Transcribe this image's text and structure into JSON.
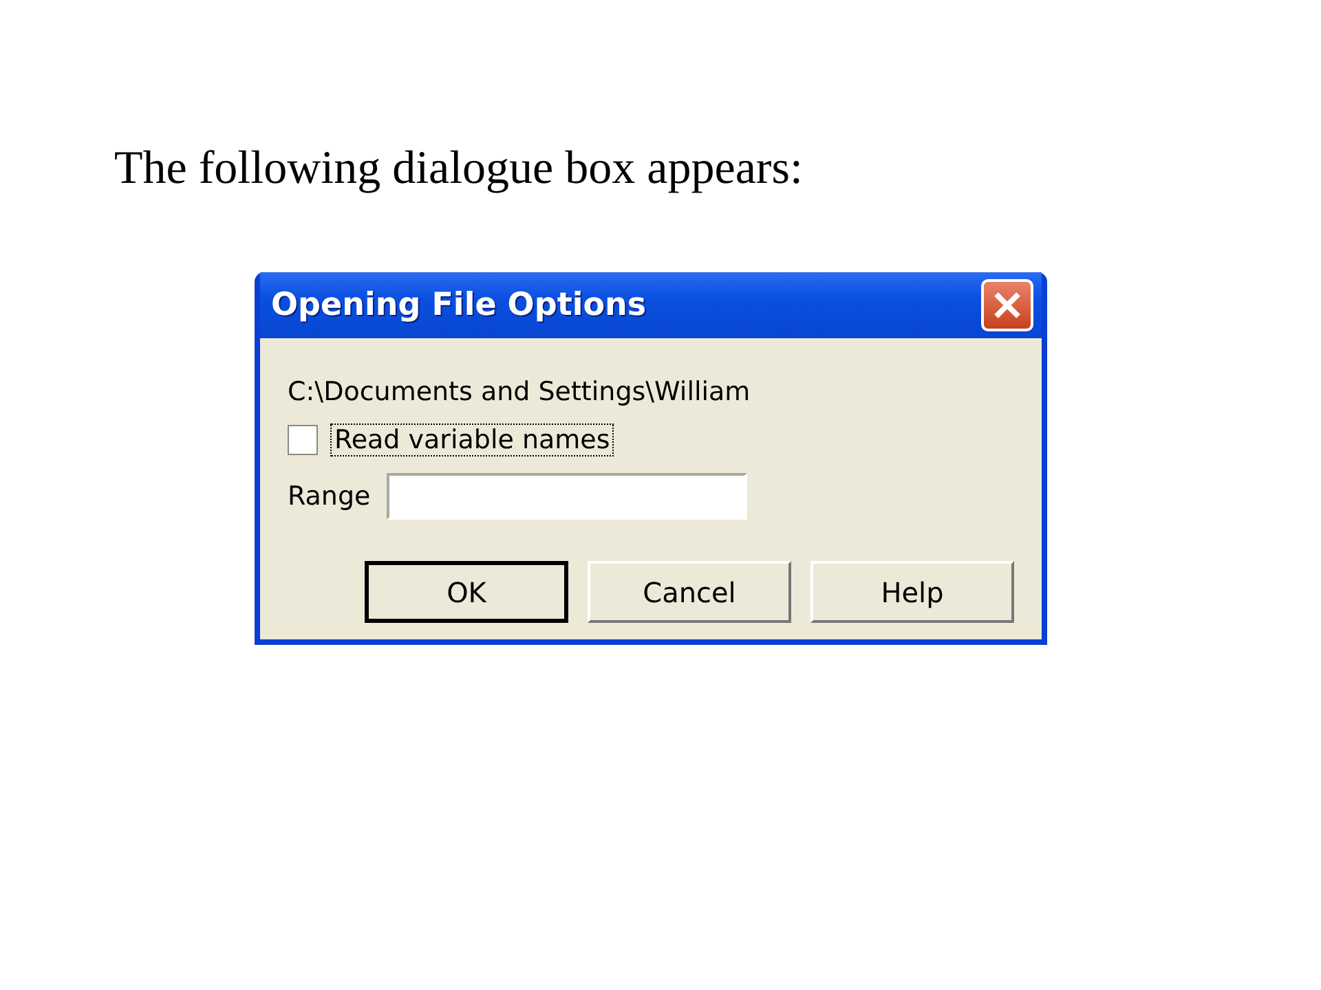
{
  "slide": {
    "heading": "The following dialogue box appears:"
  },
  "dialog": {
    "title": "Opening File Options",
    "path": "C:\\Documents and Settings\\William",
    "checkbox": {
      "label": "Read variable names",
      "checked": false,
      "focused": true
    },
    "range": {
      "label": "Range"
    },
    "buttons": [
      {
        "label": "OK",
        "default": true
      },
      {
        "label": "Cancel",
        "default": false
      },
      {
        "label": "Help",
        "default": false
      }
    ]
  }
}
